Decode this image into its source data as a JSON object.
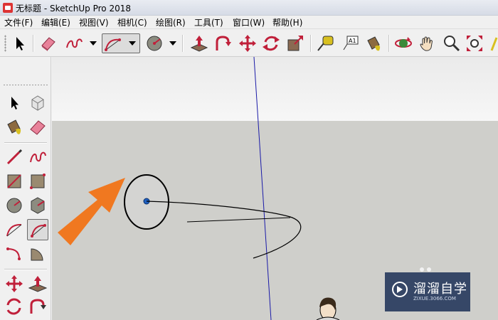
{
  "window": {
    "title": "无标题 - SketchUp Pro 2018"
  },
  "menu": {
    "file": "文件(F)",
    "edit": "编辑(E)",
    "view": "视图(V)",
    "camera": "相机(C)",
    "draw": "绘图(R)",
    "tools": "工具(T)",
    "window": "窗口(W)",
    "help": "帮助(H)"
  },
  "toolbar": {
    "tools": [
      "select",
      "eraser",
      "freehand",
      "arc",
      "circle",
      "push-pull",
      "follow-me",
      "move",
      "rotate",
      "scale",
      "tape-measure",
      "text",
      "paint-bucket",
      "orbit",
      "pan",
      "zoom",
      "zoom-extents"
    ],
    "active_tool": "arc"
  },
  "left_toolbar": {
    "tools": [
      "select",
      "component",
      "paint-bucket",
      "eraser",
      "line",
      "freehand",
      "rectangle",
      "rotated-rectangle",
      "circle",
      "polygon",
      "arc",
      "two-point-arc",
      "three-point-arc",
      "pie",
      "move",
      "push-pull",
      "rotate",
      "follow-me"
    ],
    "active_tool": "two-point-arc"
  },
  "colors": {
    "accent_arrow": "#f07820",
    "axis_blue": "#1a1aa8",
    "center_point": "#1f5fbf",
    "ground": "#cfcfcb",
    "watermark_bg": "#142850"
  },
  "watermark": {
    "main": "溜溜自学",
    "sub": "ZIXUE.3066.COM"
  }
}
